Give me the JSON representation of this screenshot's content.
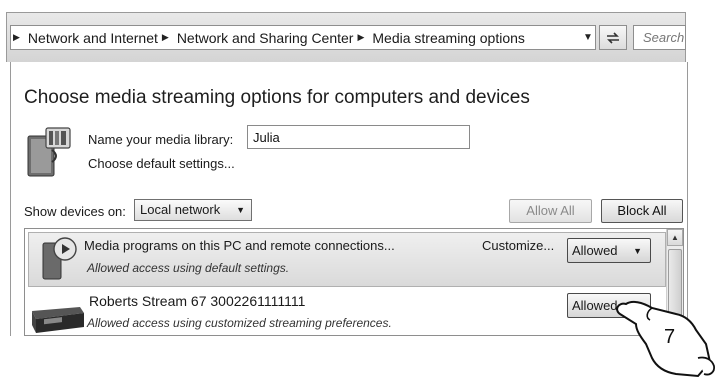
{
  "address_bar": {
    "breadcrumbs": [
      "Network and Internet",
      "Network and Sharing Center",
      "Media streaming options"
    ],
    "search_placeholder": "Search"
  },
  "page": {
    "title": "Choose media streaming options for computers and devices",
    "name_label": "Name your media library:",
    "name_value": "Julia",
    "defaults_link": "Choose default settings...",
    "show_devices_label": "Show devices on:",
    "show_devices_value": "Local network",
    "allow_all_label": "Allow All",
    "block_all_label": "Block All"
  },
  "devices": [
    {
      "title": "Media programs on this PC and remote connections...",
      "subtitle": "Allowed access using default settings.",
      "customize_label": "Customize...",
      "status": "Allowed",
      "icon": "media-player-icon"
    },
    {
      "title": "Roberts Stream 67 3002261111111",
      "subtitle": "Allowed access using customized streaming preferences.",
      "status": "Allowed",
      "icon": "radio-device-icon"
    }
  ],
  "annotation": {
    "step_number": "7",
    "icon": "pointing-hand-icon"
  }
}
